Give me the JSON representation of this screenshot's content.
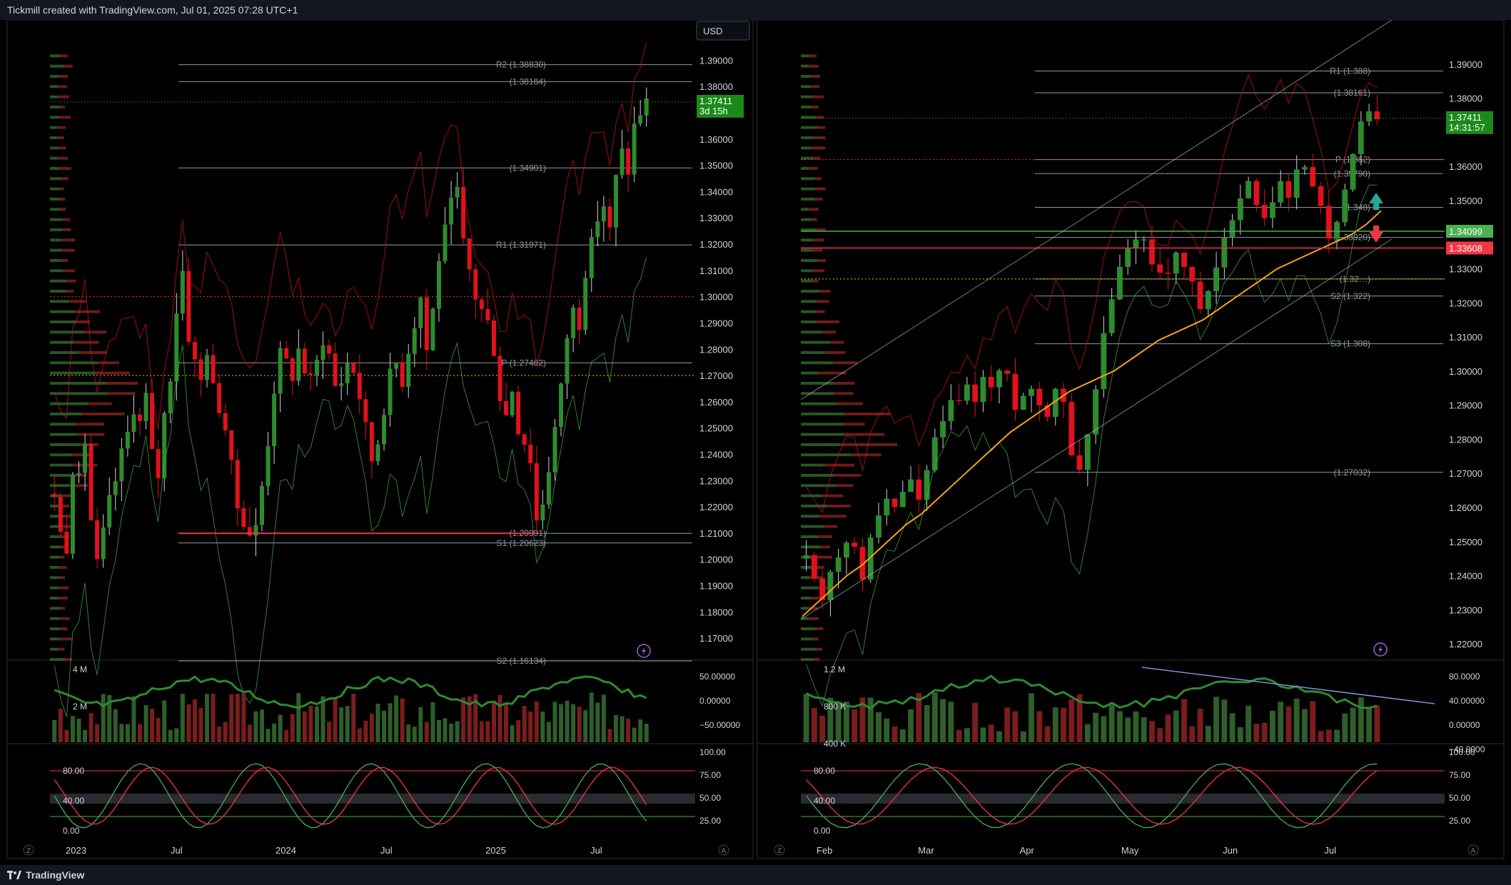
{
  "header": {
    "text": "Tickmill created with TradingView.com, Jul 01, 2025 07:28 UTC+1"
  },
  "footer": {
    "brand": "TradingView"
  },
  "colors": {
    "bg": "#000000",
    "panel_border": "#2a2e39",
    "up": "#2e8b2e",
    "down": "#e0121b",
    "text": "#d1d4dc",
    "muted": "#787b86",
    "orange": "#f7a21b",
    "green_line": "#4caf50",
    "red_line": "#f23645",
    "dotted_red": "#ff2d2d",
    "dotted_yellow": "#e6c300",
    "profile_green": "#2e5e2a",
    "profile_red": "#7a1d1d",
    "blue_line": "#2f3d9c",
    "trend_blue": "#7f8fd8"
  },
  "chart_data": [
    {
      "type": "candlestick",
      "panel": "left",
      "currency": "USD",
      "ylim": [
        1.16134,
        1.395
      ],
      "y_ticks": [
        "1.39000",
        "1.38000",
        "1.36000",
        "1.35000",
        "1.34000",
        "1.33000",
        "1.32000",
        "1.31000",
        "1.30000",
        "1.29000",
        "1.28000",
        "1.27000",
        "1.26000",
        "1.25000",
        "1.24000",
        "1.23000",
        "1.22000",
        "1.21000",
        "1.20000",
        "1.19000",
        "1.18000",
        "1.17000"
      ],
      "x_ticks": [
        "2023",
        "Jul",
        "2024",
        "Jul",
        "2025",
        "Jul"
      ],
      "last_price": {
        "label": "1.37411",
        "value": 1.37411,
        "countdown": "3d 15h"
      },
      "pivots": [
        {
          "label": "R2 (1.38830)",
          "value": 1.3883
        },
        {
          "label": "(1.38184)",
          "value": 1.38184
        },
        {
          "label": "(1.34901)",
          "value": 1.34901
        },
        {
          "label": "R1 (1.31971)",
          "value": 1.31971
        },
        {
          "label": "P (1.27482)",
          "value": 1.27482
        },
        {
          "label": "(1.20991)",
          "value": 1.20991
        },
        {
          "label": "S1 (1.20623)",
          "value": 1.20623
        },
        {
          "label": "S2 (1.16134)",
          "value": 1.16134
        }
      ],
      "price_path": [
        1.225,
        1.21,
        1.205,
        1.235,
        1.23,
        1.245,
        1.215,
        1.198,
        1.21,
        1.222,
        1.23,
        1.24,
        1.248,
        1.258,
        1.252,
        1.262,
        1.24,
        1.232,
        1.255,
        1.27,
        1.295,
        1.31,
        1.285,
        1.275,
        1.268,
        1.28,
        1.265,
        1.258,
        1.25,
        1.235,
        1.22,
        1.215,
        1.21,
        1.212,
        1.228,
        1.245,
        1.265,
        1.278,
        1.275,
        1.27,
        1.28,
        1.272,
        1.268,
        1.275,
        1.284,
        1.278,
        1.266,
        1.268,
        1.275,
        1.272,
        1.262,
        1.25,
        1.238,
        1.245,
        1.258,
        1.27,
        1.275,
        1.268,
        1.28,
        1.29,
        1.3,
        1.28,
        1.295,
        1.315,
        1.325,
        1.335,
        1.34,
        1.32,
        1.31,
        1.3,
        1.295,
        1.29,
        1.28,
        1.262,
        1.255,
        1.265,
        1.25,
        1.245,
        1.238,
        1.215,
        1.222,
        1.235,
        1.25,
        1.265,
        1.285,
        1.295,
        1.29,
        1.31,
        1.32,
        1.33,
        1.335,
        1.325,
        1.345,
        1.355,
        1.348,
        1.365,
        1.37,
        1.374
      ],
      "volume_ticks": [
        "4 M",
        "2 M"
      ],
      "volume_osc_ticks": [
        "50.00000",
        "0.00000",
        "−50.00000"
      ],
      "stoch_ticks_left": [
        "80.00",
        "40.00",
        "0.00"
      ],
      "stoch_ticks_right": [
        "100.00",
        "75.00",
        "50.00",
        "25.00"
      ]
    },
    {
      "type": "candlestick",
      "panel": "right",
      "ylim": [
        1.215,
        1.395
      ],
      "y_ticks": [
        "1.39000",
        "1.38000",
        "1.36000",
        "1.35000",
        "1.33000",
        "1.32000",
        "1.31000",
        "1.30000",
        "1.29000",
        "1.28000",
        "1.27000",
        "1.26000",
        "1.25000",
        "1.24000",
        "1.23000",
        "1.22000"
      ],
      "x_ticks": [
        "Feb",
        "Mar",
        "Apr",
        "May",
        "Jun",
        "Jul"
      ],
      "last_price": {
        "label": "1.37411",
        "value": 1.37411,
        "countdown": "14:31:57"
      },
      "level_labels": [
        {
          "label": "1.34099",
          "value": 1.34099,
          "color": "#4caf50"
        },
        {
          "label": "1.33608",
          "value": 1.33608,
          "color": "#f23645"
        }
      ],
      "pivots": [
        {
          "label": "R1 (1.388)",
          "value": 1.388
        },
        {
          "label": "(1.38161)",
          "value": 1.38161
        },
        {
          "label": "P (1.362)",
          "value": 1.362
        },
        {
          "label": "(1.35790)",
          "value": 1.3579
        },
        {
          "label": "(1.348)",
          "value": 1.348
        },
        {
          "label": "(1.33920)",
          "value": 1.3392
        },
        {
          "label": "(1.32…)",
          "value": 1.327
        },
        {
          "label": "S2 (1.322)",
          "value": 1.322
        },
        {
          "label": "S3 (1.308)",
          "value": 1.308
        },
        {
          "label": "(1.27032)",
          "value": 1.2703
        }
      ],
      "price_path": [
        1.245,
        1.238,
        1.232,
        1.24,
        1.245,
        1.25,
        1.248,
        1.238,
        1.252,
        1.258,
        1.262,
        1.26,
        1.265,
        1.268,
        1.262,
        1.27,
        1.28,
        1.285,
        1.29,
        1.292,
        1.295,
        1.292,
        1.298,
        1.295,
        1.3,
        1.298,
        1.29,
        1.293,
        1.295,
        1.29,
        1.288,
        1.295,
        1.292,
        1.275,
        1.272,
        1.282,
        1.295,
        1.31,
        1.322,
        1.33,
        1.335,
        1.34,
        1.338,
        1.332,
        1.33,
        1.328,
        1.335,
        1.33,
        1.325,
        1.318,
        1.322,
        1.33,
        1.338,
        1.345,
        1.352,
        1.355,
        1.348,
        1.345,
        1.35,
        1.355,
        1.352,
        1.358,
        1.36,
        1.355,
        1.348,
        1.34,
        1.345,
        1.352,
        1.365,
        1.372,
        1.375,
        1.374
      ],
      "orange_ma": [
        1.228,
        1.232,
        1.236,
        1.24,
        1.243,
        1.247,
        1.251,
        1.255,
        1.258,
        1.262,
        1.266,
        1.27,
        1.274,
        1.278,
        1.282,
        1.285,
        1.288,
        1.291,
        1.294,
        1.296,
        1.298,
        1.3,
        1.303,
        1.306,
        1.309,
        1.311,
        1.313,
        1.315,
        1.318,
        1.321,
        1.324,
        1.327,
        1.33,
        1.332,
        1.334,
        1.336,
        1.338,
        1.34,
        1.343,
        1.347
      ],
      "volume_ticks": [
        "1.2 M",
        "800 K",
        "400 K"
      ],
      "volume_osc_ticks": [
        "80.0000",
        "40.00000",
        "0.00000",
        "−40.0000"
      ],
      "stoch_ticks_left": [
        "80.00",
        "40.00",
        "0.00"
      ],
      "stoch_ticks_right": [
        "100.00",
        "75.00",
        "50.00",
        "25.00"
      ]
    }
  ]
}
